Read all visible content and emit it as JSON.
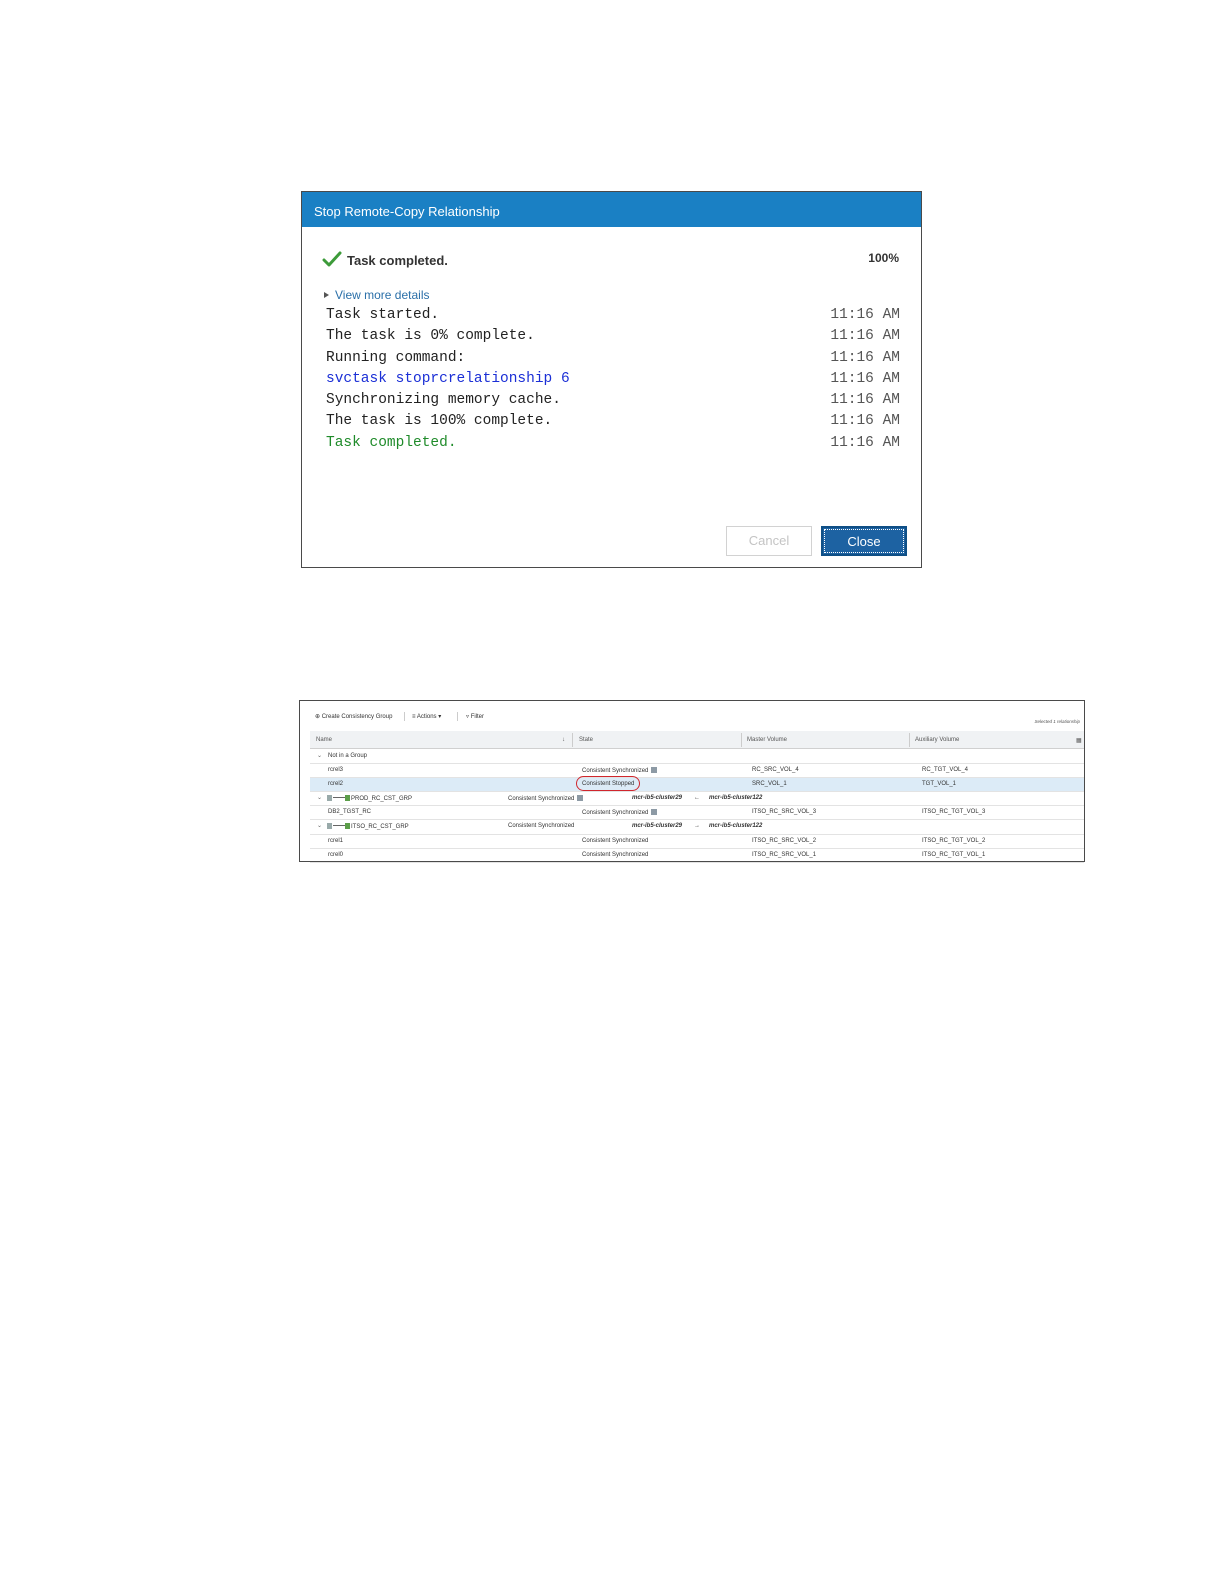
{
  "dialog": {
    "title": "Stop Remote-Copy Relationship",
    "status": "Task completed.",
    "percent": "100%",
    "details_link": "View more details",
    "log": [
      {
        "message": "Task started.",
        "time": "11:16 AM"
      },
      {
        "message": "The task is 0% complete.",
        "time": "11:16 AM"
      },
      {
        "message": "Running command:",
        "time": "11:16 AM"
      },
      {
        "message": "svctask stoprcrelationship 6",
        "time": "11:16 AM"
      },
      {
        "message": "Synchronizing memory cache.",
        "time": "11:16 AM"
      },
      {
        "message": "The task is 100% complete.",
        "time": "11:16 AM"
      },
      {
        "message": "Task completed.",
        "time": "11:16 AM"
      }
    ],
    "cancel_label": "Cancel",
    "close_label": "Close"
  },
  "table": {
    "toolbar": {
      "create_label": "Create Consistency Group",
      "actions_label": "Actions",
      "filter_label": "Filter",
      "right_label": "Selected 1 relationship"
    },
    "columns": [
      "Name",
      "State",
      "Master Volume",
      "Auxiliary Volume"
    ],
    "rows": [
      {
        "type": "group",
        "name": "Not in a Group",
        "state": "",
        "master": "",
        "aux": ""
      },
      {
        "type": "item",
        "name": "rcrel3",
        "state": "Consistent Synchronized",
        "master": "RC_SRC_VOL_4",
        "aux": "RC_TGT_VOL_4"
      },
      {
        "type": "item",
        "name": "rcrel2",
        "state": "Consistent Stopped",
        "master": "SRC_VOL_1",
        "aux": "TGT_VOL_1"
      },
      {
        "type": "cg",
        "name": "PROD_RC_CST_GRP",
        "state": "Consistent Synchronized",
        "master": "mcr-ib5-cluster29",
        "arrow": "←",
        "aux": "mcr-ib5-cluster122"
      },
      {
        "type": "item",
        "name": "DB2_TGST_RC",
        "state": "Consistent Synchronized",
        "master": "ITSO_RC_SRC_VOL_3",
        "aux": "ITSO_RC_TGT_VOL_3"
      },
      {
        "type": "cg",
        "name": "ITSO_RC_CST_GRP",
        "state": "Consistent Synchronized",
        "master": "mcr-ib5-cluster29",
        "arrow": "→",
        "aux": "mcr-ib5-cluster122"
      },
      {
        "type": "item",
        "name": "rcrel1",
        "state": "Consistent Synchronized",
        "master": "ITSO_RC_SRC_VOL_2",
        "aux": "ITSO_RC_TGT_VOL_2"
      },
      {
        "type": "item",
        "name": "rcrel0",
        "state": "Consistent Synchronized",
        "master": "ITSO_RC_SRC_VOL_1",
        "aux": "ITSO_RC_TGT_VOL_1"
      }
    ]
  }
}
